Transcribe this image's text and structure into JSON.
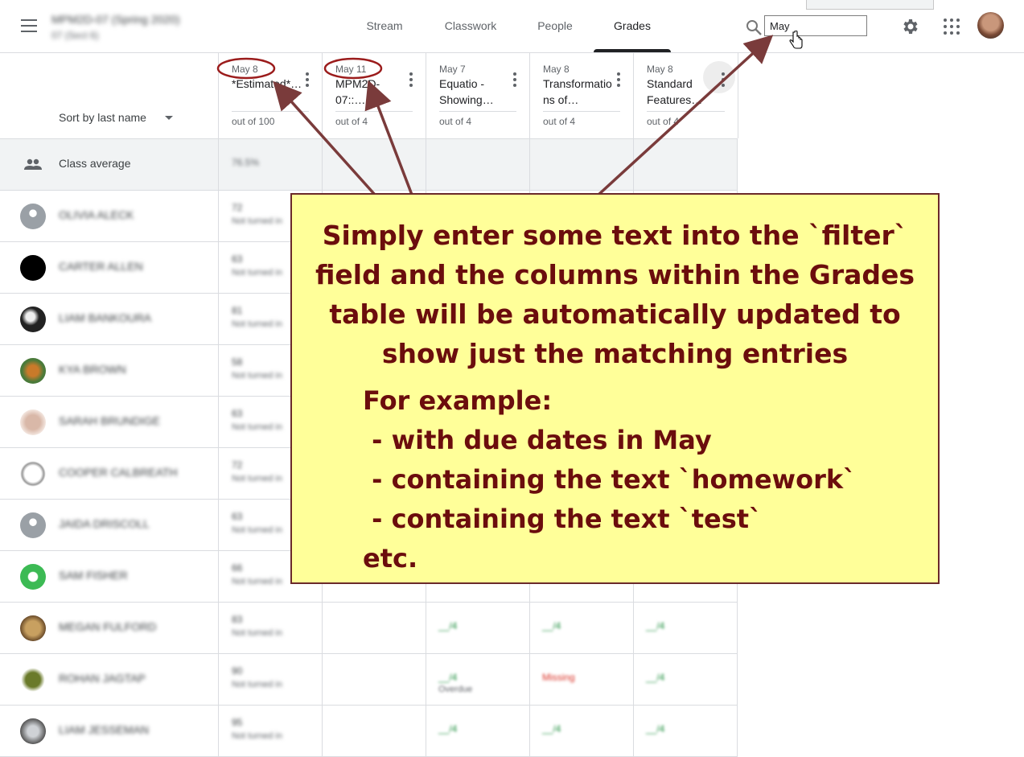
{
  "header": {
    "course_title": "MPM2D-07 (Spring 2020)",
    "course_subtitle": "07 (Sect 6)",
    "tabs": [
      {
        "label": "Stream",
        "active": false
      },
      {
        "label": "Classwork",
        "active": false
      },
      {
        "label": "People",
        "active": false
      },
      {
        "label": "Grades",
        "active": true
      }
    ],
    "filter_value": "May",
    "icons": [
      "menu-icon",
      "search-icon",
      "settings-gear-icon",
      "apps-grid-icon"
    ]
  },
  "grid": {
    "sort_label": "Sort by last name",
    "columns": [
      {
        "date": "May 8",
        "title": "*Estimated*…",
        "out_of": "out of 100"
      },
      {
        "date": "May 11",
        "title": "MPM2D-07::…",
        "out_of": "out of 4"
      },
      {
        "date": "May 7",
        "title": "Equatio - Showing…",
        "out_of": "out of 4"
      },
      {
        "date": "May 8",
        "title": "Transformations of…",
        "out_of": "out of 4"
      },
      {
        "date": "May 8",
        "title": "Standard Features…",
        "out_of": "out of 4"
      }
    ],
    "class_average": {
      "label": "Class average",
      "value": "76.5%"
    },
    "students": [
      {
        "name": "OLIVIA ALECK",
        "grade": "72",
        "grade_sub": "Not turned in",
        "c3": "",
        "c4": "",
        "c5": ""
      },
      {
        "name": "CARTER ALLEN",
        "grade": "63",
        "grade_sub": "Not turned in",
        "c3": "",
        "c4": "",
        "c5": ""
      },
      {
        "name": "LIAM BANKOURA",
        "grade": "81",
        "grade_sub": "Not turned in",
        "c3": "",
        "c4": "",
        "c5": ""
      },
      {
        "name": "KYA BROWN",
        "grade": "58",
        "grade_sub": "Not turned in",
        "c3": "",
        "c4": "",
        "c5": ""
      },
      {
        "name": "SARAH BRUNDIGE",
        "grade": "63",
        "grade_sub": "Not turned in",
        "c3": "",
        "c4": "",
        "c5": ""
      },
      {
        "name": "COOPER CALBREATH",
        "grade": "72",
        "grade_sub": "Not turned in",
        "c3": "",
        "c4": "",
        "c5": ""
      },
      {
        "name": "JAIDA DRISCOLL",
        "grade": "63",
        "grade_sub": "Not turned in",
        "c3": "",
        "c4": "",
        "c5": ""
      },
      {
        "name": "SAM FISHER",
        "grade": "66",
        "grade_sub": "Not turned in",
        "c3": "",
        "c4": "",
        "c5": ""
      },
      {
        "name": "MEGAN FULFORD",
        "grade": "83",
        "grade_sub": "Not turned in",
        "c3": "__/4",
        "c4": "__/4",
        "c5": "__/4"
      },
      {
        "name": "ROHAN JAGTAP",
        "grade": "90",
        "grade_sub": "Not turned in",
        "c3": "__/4",
        "c3_sub": "Overdue",
        "c4": "Missing",
        "c5": "__/4"
      },
      {
        "name": "LIAM JESSEMAN",
        "grade": "95",
        "grade_sub": "Not turned in",
        "c3": "__/4",
        "c4": "__/4",
        "c5": "__/4"
      }
    ]
  },
  "callout": {
    "main_text": "Simply enter some text into the `filter` field and the columns within the Grades table will be automatically updated to show just the matching entries",
    "examples_text": "For example:\n - with due dates in May\n - containing the text `homework`\n - containing the text `test`\netc."
  },
  "colors": {
    "callout_bg": "#ffff99",
    "callout_text": "#6b0d0d",
    "annotation": "#7a3b3b",
    "highlight_ring": "#9b1c1c"
  }
}
